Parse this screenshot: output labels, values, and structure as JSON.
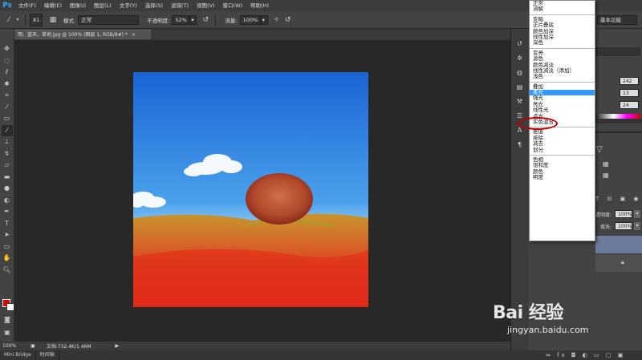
{
  "app": {
    "logo": "Ps",
    "menus": [
      "文件(F)",
      "编辑(E)",
      "图像(I)",
      "图层(L)",
      "文字(Y)",
      "选择(S)",
      "滤镜(T)",
      "视图(V)",
      "窗口(W)",
      "帮助(H)"
    ]
  },
  "options": {
    "brush_size": "81",
    "mode_label": "模式:",
    "mode_value": "正常",
    "opacity_label": "不透明度:",
    "opacity_value": "52%",
    "flow_label": "流量:",
    "flow_value": "100%",
    "workspace": "基本功能"
  },
  "document": {
    "tab_title": "明、蓝天、草地.jpg @ 100% (图层 1, RGB/8#) *",
    "zoom": "100%",
    "doc_info": "文档:732.4K/1.46M"
  },
  "bottom_tabs": [
    "Mini Bridge",
    "时间轴"
  ],
  "panel": {
    "values": [
      "242",
      "13",
      "24"
    ],
    "opacity_label": "透明度:",
    "opacity_value": "100%",
    "fill_label": "填充:",
    "fill_value": "100%"
  },
  "blend_modes": [
    [
      "正常",
      "溶解"
    ],
    [
      "变暗",
      "正片叠底",
      "颜色加深",
      "线性加深",
      "深色"
    ],
    [
      "变亮",
      "滤色",
      "颜色减淡",
      "线性减淡（添加）",
      "浅色"
    ],
    [
      "叠加",
      "柔光",
      "强光",
      "亮光",
      "线性光",
      "点光",
      "实色混合"
    ],
    [
      "差值",
      "排除",
      "减去",
      "划分"
    ],
    [
      "色相",
      "饱和度",
      "颜色",
      "明度"
    ]
  ],
  "selected_mode": "柔光",
  "watermark": {
    "logo": "Bai 经验",
    "url": "jingyan.baidu.com"
  },
  "colors": {
    "foreground": "#e00000",
    "background": "#ffffff",
    "selection": "#3399ff",
    "highlight": "#c00000"
  }
}
